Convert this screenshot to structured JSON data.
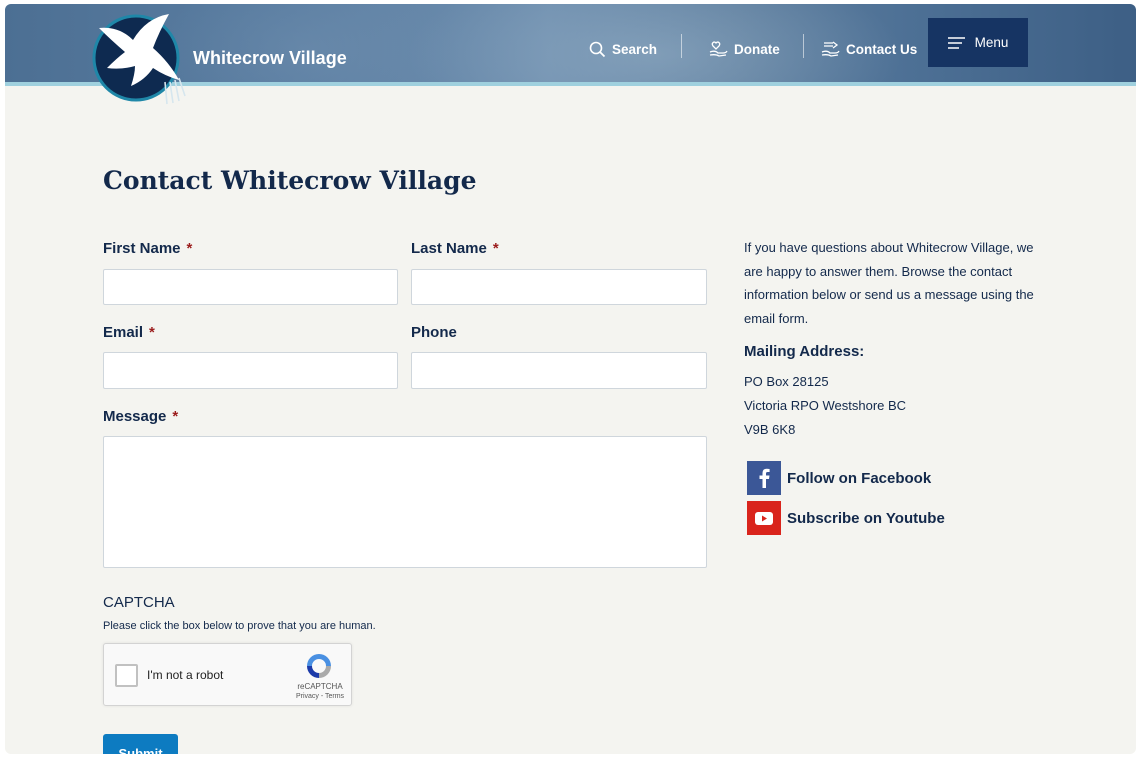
{
  "header": {
    "site_title": "Whitecrow Village",
    "nav": {
      "search_label": "Search",
      "donate_label": "Donate",
      "contact_label": "Contact Us",
      "menu_label": "Menu"
    },
    "icons": [
      "bird-logo-icon",
      "search-icon",
      "hands-heart-icon",
      "hands-contact-icon",
      "hamburger-icon"
    ]
  },
  "main": {
    "title": "Contact Whitecrow Village",
    "form": {
      "first_name_label": "First Name",
      "last_name_label": "Last Name",
      "email_label": "Email",
      "phone_label": "Phone",
      "message_label": "Message",
      "required_marker": "*",
      "first_name_value": "",
      "last_name_value": "",
      "email_value": "",
      "phone_value": "",
      "message_value": ""
    },
    "captcha": {
      "title": "CAPTCHA",
      "help": "Please click the box below to prove that you are human.",
      "checkbox_label": "I'm not a robot",
      "brand": "reCAPTCHA",
      "terms": "Privacy - Terms",
      "checked": false
    },
    "submit_label": "Submit"
  },
  "sidebar": {
    "intro": "If you have questions about Whitecrow Village, we are happy to answer them. Browse the contact information below or send us a message using the email form.",
    "mailing_title": "Mailing Address:",
    "address_lines": [
      "PO Box 28125",
      "Victoria RPO Westshore BC",
      "V9B 6K8"
    ],
    "social": [
      {
        "label": "Follow on Facebook",
        "icon": "facebook-icon"
      },
      {
        "label": "Subscribe on Youtube",
        "icon": "youtube-icon"
      }
    ]
  },
  "colors": {
    "header_blue": "#4c6f93",
    "menu_navy": "#163463",
    "page_bg": "#f4f4f0",
    "text_navy": "#13294b",
    "required_red": "#9b1c1c",
    "submit_blue": "#0d7bc1",
    "facebook_blue": "#3b5797",
    "youtube_red": "#d9241c",
    "accent_stripe": "#9fd0de"
  }
}
